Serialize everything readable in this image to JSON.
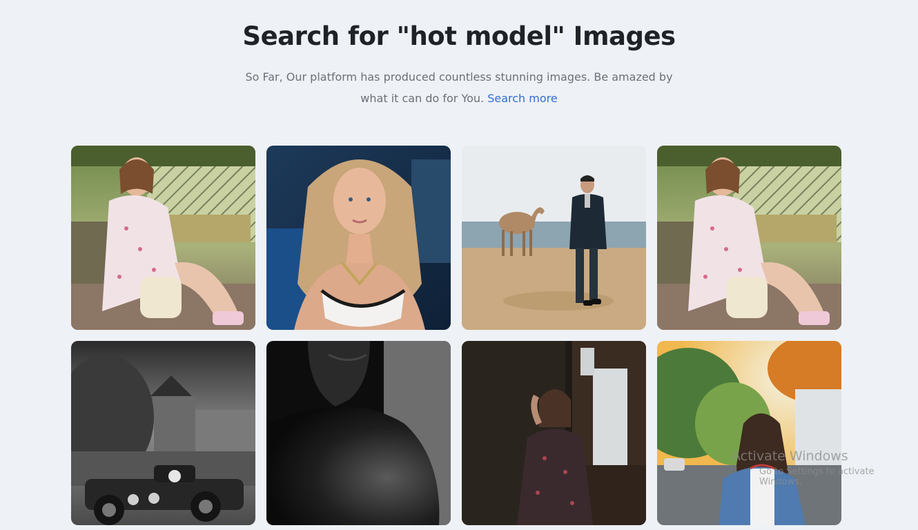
{
  "header": {
    "title": "Search for \"hot model\" Images",
    "subtitle": "So Far, Our platform has produced countless stunning images. Be amazed by what it can do for You.",
    "link_label": "Search more"
  },
  "images": [
    {
      "name": "photo-woman-on-bench-garden"
    },
    {
      "name": "photo-curly-blonde-woman"
    },
    {
      "name": "photo-man-with-camel-beach"
    },
    {
      "name": "photo-woman-on-bench-garden"
    },
    {
      "name": "photo-vintage-car-castle-bw"
    },
    {
      "name": "photo-shoulder-closeup-bw"
    },
    {
      "name": "photo-woman-by-window"
    },
    {
      "name": "photo-woman-denim-jacket-street"
    }
  ],
  "watermark": {
    "line1": "Activate Windows",
    "line2": "Go to Settings to activate Windows."
  }
}
